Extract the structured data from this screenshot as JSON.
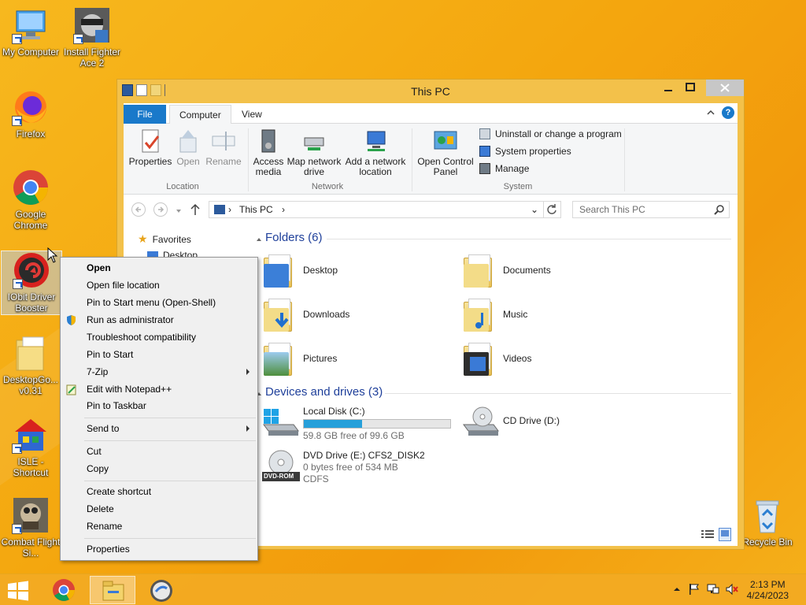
{
  "desktop": {
    "icons": [
      {
        "label": "My Computer"
      },
      {
        "label": "Install Fighter Ace 2"
      },
      {
        "label": "Firefox"
      },
      {
        "label": "Google Chrome"
      },
      {
        "label": "IObit Driver Booster"
      },
      {
        "label": "DesktopGo... v0.31"
      },
      {
        "label": "ISLE - Shortcut"
      },
      {
        "label": "Combat Flight Si..."
      },
      {
        "label": "Recycle Bin"
      }
    ]
  },
  "explorer": {
    "title": "This PC",
    "tabs": {
      "file": "File",
      "computer": "Computer",
      "view": "View"
    },
    "ribbon": {
      "properties": "Properties",
      "open": "Open",
      "rename": "Rename",
      "location_group": "Location",
      "access_media": "Access media",
      "map_network_drive": "Map network drive",
      "add_network_location": "Add a network location",
      "network_group": "Network",
      "open_control_panel": "Open Control Panel",
      "uninstall": "Uninstall or change a program",
      "system_properties": "System properties",
      "manage": "Manage",
      "system_group": "System"
    },
    "address": "This PC",
    "search_placeholder": "Search This PC",
    "nav": {
      "favorites": "Favorites",
      "desktop": "Desktop"
    },
    "folders_header": "Folders (6)",
    "folders": [
      "Desktop",
      "Documents",
      "Downloads",
      "Music",
      "Pictures",
      "Videos"
    ],
    "devices_header": "Devices and drives (3)",
    "drives": {
      "c": {
        "name": "Local Disk (C:)",
        "free": "59.8 GB free of 99.6 GB",
        "used_fraction": 0.4
      },
      "d": {
        "name": "CD Drive (D:)"
      },
      "e": {
        "name": "DVD Drive (E:) CFS2_DISK2",
        "free": "0 bytes free of 534 MB",
        "fs": "CDFS",
        "badge": "DVD-ROM"
      }
    }
  },
  "context_menu": {
    "items": [
      "Open",
      "Open file location",
      "Pin to Start menu (Open-Shell)",
      "Run as administrator",
      "Troubleshoot compatibility",
      "Pin to Start",
      "7-Zip",
      "Edit with Notepad++",
      "Pin to Taskbar",
      "Send to",
      "Cut",
      "Copy",
      "Create shortcut",
      "Delete",
      "Rename",
      "Properties"
    ]
  },
  "taskbar": {
    "time": "2:13 PM",
    "date": "4/24/2023"
  },
  "colors": {
    "accent": "#1979ca",
    "progress": "#26a0da",
    "wallpaper": "#f4a60e"
  }
}
